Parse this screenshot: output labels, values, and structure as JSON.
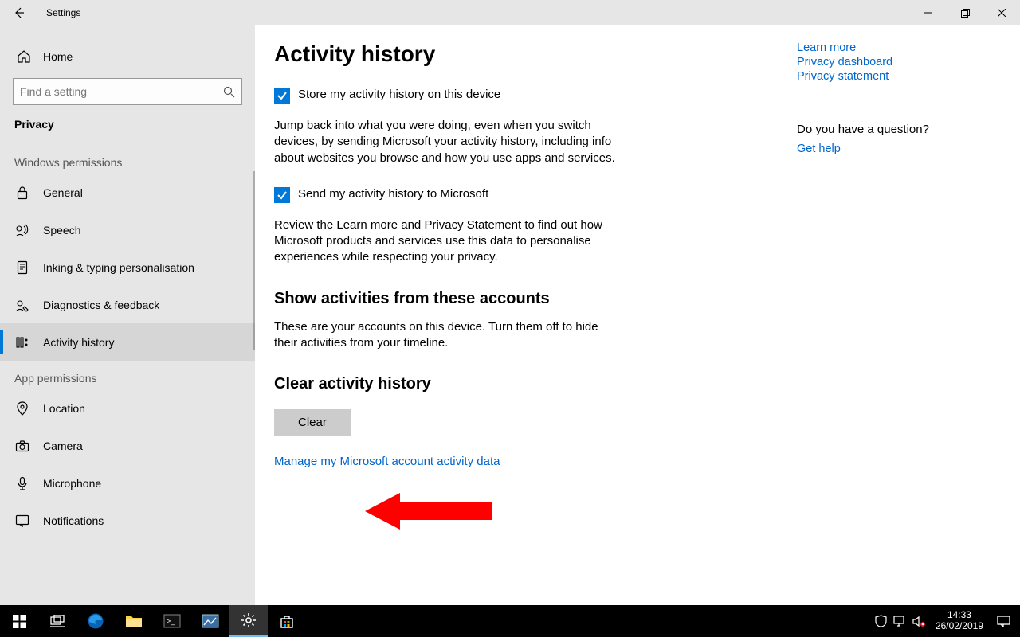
{
  "window": {
    "title": "Settings"
  },
  "sidebar": {
    "home_label": "Home",
    "search_placeholder": "Find a setting",
    "current_section": "Privacy",
    "groups": [
      {
        "label": "Windows permissions",
        "items": [
          {
            "icon": "lock",
            "label": "General"
          },
          {
            "icon": "speech",
            "label": "Speech"
          },
          {
            "icon": "inking",
            "label": "Inking & typing personalisation"
          },
          {
            "icon": "diagnostics",
            "label": "Diagnostics & feedback"
          },
          {
            "icon": "activity",
            "label": "Activity history",
            "active": true
          }
        ]
      },
      {
        "label": "App permissions",
        "items": [
          {
            "icon": "location",
            "label": "Location"
          },
          {
            "icon": "camera",
            "label": "Camera"
          },
          {
            "icon": "microphone",
            "label": "Microphone"
          },
          {
            "icon": "notifications",
            "label": "Notifications"
          }
        ]
      }
    ]
  },
  "main": {
    "title": "Activity history",
    "checkbox1_label": "Store my activity history on this device",
    "paragraph1": "Jump back into what you were doing, even when you switch devices, by sending Microsoft your activity history, including info about websites you browse and how you use apps and services.",
    "checkbox2_label": "Send my activity history to Microsoft",
    "paragraph2": "Review the Learn more and Privacy Statement to find out how Microsoft products and services use this data to personalise experiences while respecting your privacy.",
    "subheading_accounts": "Show activities from these accounts",
    "paragraph_accounts": "These are your accounts on this device. Turn them off to hide their activities from your timeline.",
    "subheading_clear": "Clear activity history",
    "clear_button": "Clear",
    "manage_link": "Manage my Microsoft account activity data"
  },
  "right": {
    "links": [
      "Learn more",
      "Privacy dashboard",
      "Privacy statement"
    ],
    "question": "Do you have a question?",
    "gethelp": "Get help"
  },
  "taskbar": {
    "time": "14:33",
    "date": "26/02/2019"
  }
}
